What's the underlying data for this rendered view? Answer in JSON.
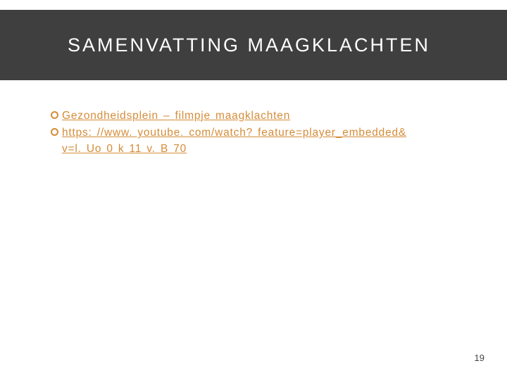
{
  "title": "SAMENVATTING MAAGKLACHTEN",
  "bullets": [
    {
      "text": "Gezondheidsplein – filmpje maagklachten"
    },
    {
      "text": "https: //www. youtube. com/watch? feature=player_embedded&",
      "continuation": "v=l. Uo 0 k 11 v. B 70"
    }
  ],
  "page_number": "19"
}
